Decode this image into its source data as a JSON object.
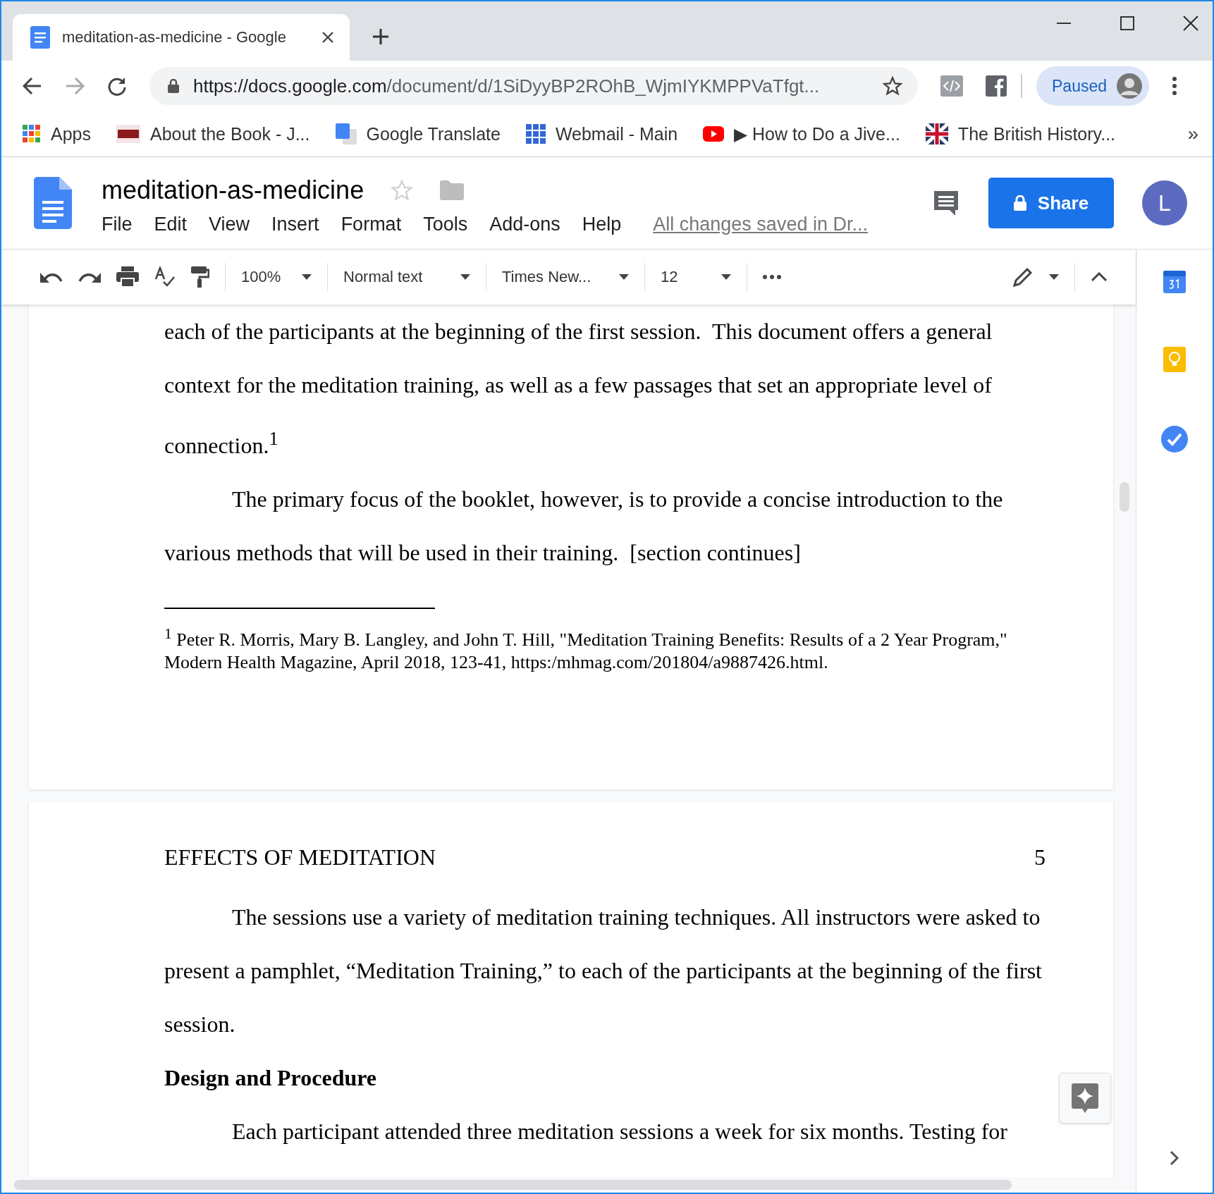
{
  "browser": {
    "tab": {
      "title": "meditation-as-medicine - Google",
      "selected": true
    },
    "address": {
      "host": "https://docs.google.com",
      "path": "/document/d/1SiDyyBP2ROhB_WjmIYKMPPVaTfgt..."
    },
    "profile": {
      "label": "Paused"
    },
    "bookmarks": [
      {
        "kind": "apps",
        "label": "Apps"
      },
      {
        "kind": "book",
        "label": "About the Book - J..."
      },
      {
        "kind": "translate",
        "label": "Google Translate"
      },
      {
        "kind": "webmail",
        "label": "Webmail - Main"
      },
      {
        "kind": "video",
        "label": "▶ How to Do a Jive..."
      },
      {
        "kind": "flag",
        "label": "The British History..."
      }
    ],
    "overflow": "»"
  },
  "doc": {
    "title": "meditation-as-medicine",
    "starred": false,
    "menus": [
      "File",
      "Edit",
      "View",
      "Insert",
      "Format",
      "Tools",
      "Add-ons",
      "Help"
    ],
    "save_status": "All changes saved in Dr...",
    "share": "Share",
    "avatar": "L"
  },
  "toolbar": {
    "zoom": "100%",
    "style": "Normal text",
    "font": "Times New...",
    "size": "12"
  },
  "pages": [
    {
      "blocks": [
        {
          "kind": "paragraph",
          "indent": false,
          "lines": [
            "each of the participants at the beginning of the first session.  This document offers a general",
            "context for the meditation training, as well as a few passages that set an appropriate level of",
            "connection.$^{1}$"
          ]
        },
        {
          "kind": "paragraph",
          "indent": true,
          "lines": [
            "The primary focus of the booklet, however, is to provide a concise introduction to the",
            "various methods that will be used in their training.  [section continues]"
          ]
        },
        {
          "kind": "footnote",
          "lines": [
            "$^{1}$ Peter R. Morris, Mary B. Langley, and John T. Hill, \"Meditation Training Benefits: Results of a 2 Year Program,\"",
            "Modern Health Magazine, April 2018, 123-41, https:/mhmag.com/201804/a9887426.html."
          ]
        }
      ]
    },
    {
      "blocks": [
        {
          "kind": "header",
          "text": "EFFECTS OF MEDITATION",
          "page_number": "5"
        },
        {
          "kind": "paragraph",
          "indent": true,
          "lines": [
            "The sessions use a variety of meditation training techniques. All instructors were asked to",
            "present a pamphlet, “Meditation Training,” to each of the participants at the beginning of the first",
            "session."
          ]
        },
        {
          "kind": "heading",
          "text": "Design and Procedure"
        },
        {
          "kind": "paragraph",
          "indent": true,
          "lines": [
            "Each participant attended three meditation sessions a week for six months. Testing for"
          ]
        }
      ]
    }
  ]
}
